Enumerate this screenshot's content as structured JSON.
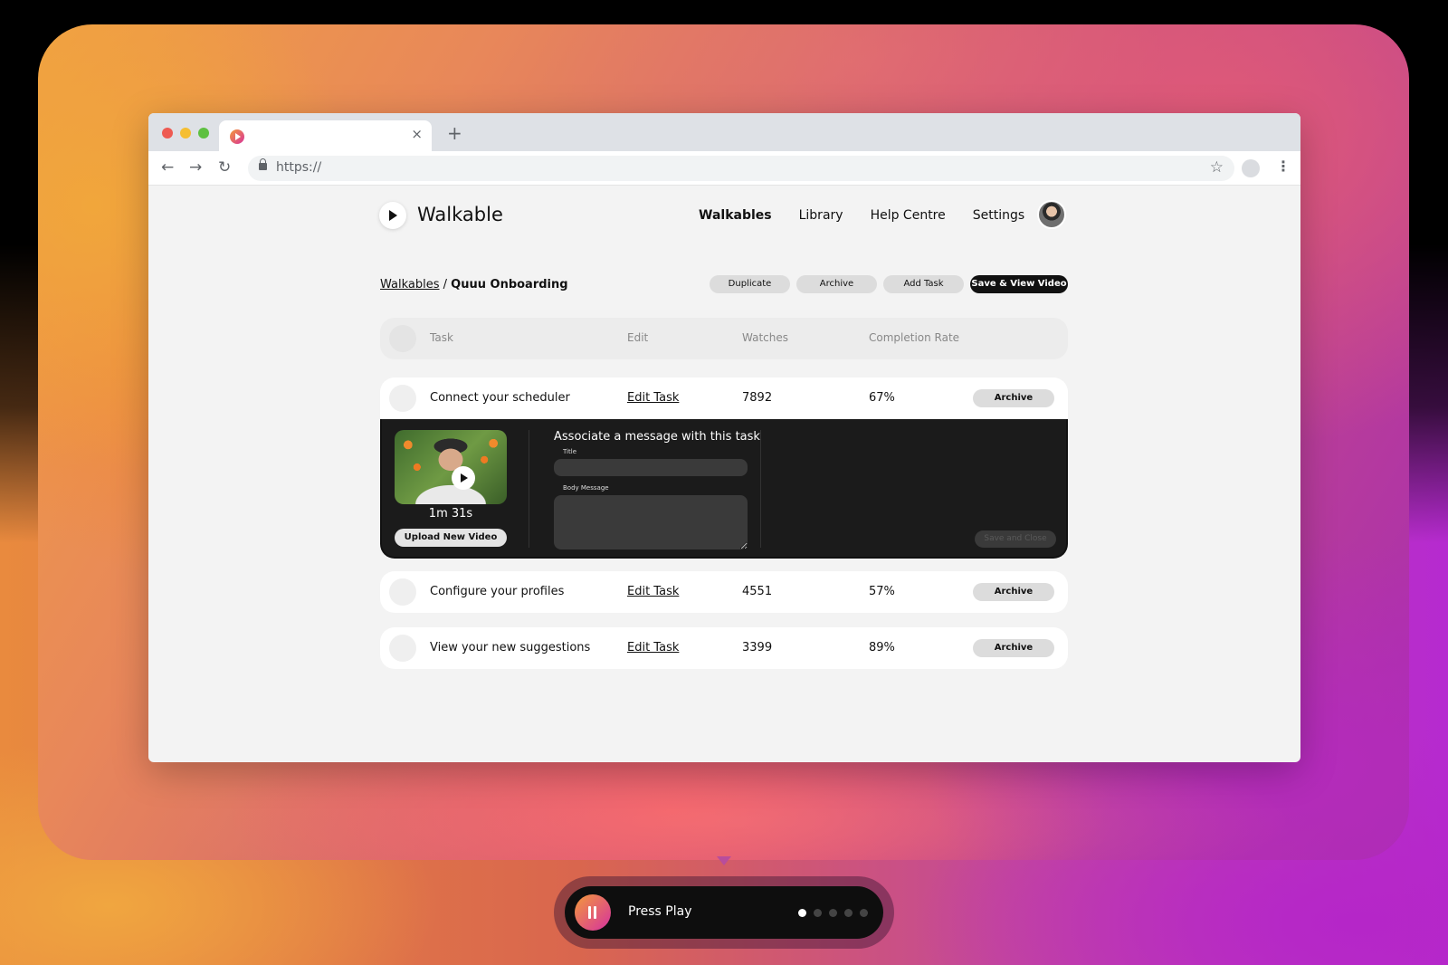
{
  "browser": {
    "url": "https://",
    "tab_close": "×",
    "new_tab": "+",
    "back": "←",
    "forward": "→",
    "reload": "↻",
    "star": "☆",
    "menu": "⋮"
  },
  "app": {
    "logo_text": "Walkable",
    "nav": [
      "Walkables",
      "Library",
      "Help Centre",
      "Settings"
    ],
    "nav_active": "Walkables"
  },
  "breadcrumb": {
    "parent": "Walkables",
    "separator": " / ",
    "current": "Quuu Onboarding"
  },
  "actions": {
    "duplicate": "Duplicate",
    "archive": "Archive",
    "add_task": "Add Task",
    "save_view": "Save & View Video"
  },
  "table": {
    "headers": {
      "task": "Task",
      "edit": "Edit",
      "watches": "Watches",
      "completion_rate": "Completion Rate"
    },
    "rows": [
      {
        "task": "Connect your scheduler",
        "edit": "Edit Task",
        "watches": "7892",
        "rate": "67%",
        "archive": "Archive"
      },
      {
        "task": "Configure your profiles",
        "edit": "Edit Task",
        "watches": "4551",
        "rate": "57%",
        "archive": "Archive"
      },
      {
        "task": "View your new suggestions",
        "edit": "Edit Task",
        "watches": "3399",
        "rate": "89%",
        "archive": "Archive"
      }
    ]
  },
  "expanded": {
    "duration": "1m 31s",
    "upload": "Upload New Video",
    "message_title": "Associate a message with this task",
    "title_label": "Title",
    "body_label": "Body Message",
    "save_close": "Save and Close"
  },
  "player": {
    "label": "Press Play",
    "total_steps": 5,
    "current_step": 1
  },
  "colors": {
    "accent_gradient_start": "#f39a3a",
    "accent_gradient_end": "#d6319f",
    "primary_button": "#111111",
    "secondary_button": "#dcdcdc"
  }
}
